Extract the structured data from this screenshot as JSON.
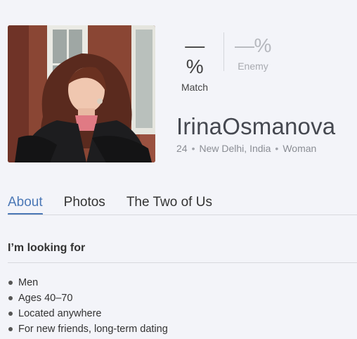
{
  "profile": {
    "username": "IrinaOsmanova",
    "age": "24",
    "location": "New Delhi, India",
    "gender": "Woman",
    "separator": "•"
  },
  "match": {
    "value": "—%",
    "label": "Match"
  },
  "enemy": {
    "value": "—%",
    "label": "Enemy"
  },
  "tabs": [
    {
      "label": "About",
      "active": true
    },
    {
      "label": "Photos",
      "active": false
    },
    {
      "label": "The Two of Us",
      "active": false
    }
  ],
  "looking_for": {
    "title": "I’m looking for",
    "items": [
      "Men",
      "Ages 40–70",
      "Located anywhere",
      "For new friends, long-term dating"
    ]
  },
  "colors": {
    "accent": "#4b78b6",
    "background": "#f3f4f9"
  }
}
